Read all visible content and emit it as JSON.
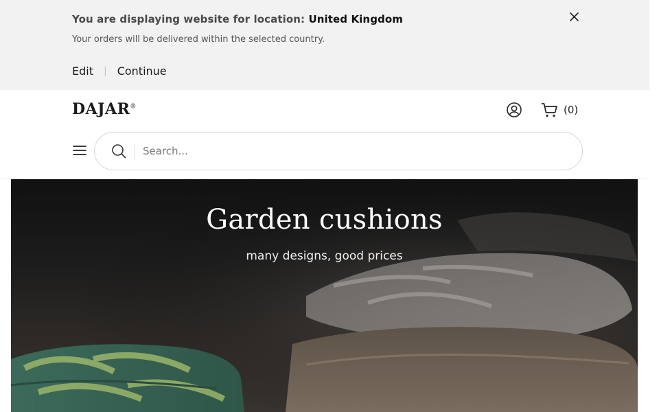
{
  "location_banner": {
    "title_prefix": "You are displaying website for location:",
    "country": "United Kingdom",
    "subtitle": "Your orders will be delivered within the selected country.",
    "edit_label": "Edit",
    "separator": "|",
    "continue_label": "Continue",
    "close_icon": "close-icon"
  },
  "header": {
    "logo_text": "DAJAR",
    "logo_mark": "®",
    "account_icon": "user-circle-icon",
    "cart_icon": "shopping-cart-icon",
    "cart_count": "(0)",
    "menu_icon": "hamburger-menu-icon"
  },
  "search": {
    "placeholder": "Search...",
    "value": "",
    "icon": "search-icon"
  },
  "hero": {
    "title": "Garden cushions",
    "subtitle": "many designs, good prices"
  },
  "colors": {
    "banner_bg": "#f2f2f2",
    "text_dark": "#1a1a1a",
    "hero_text": "#fbfbfb"
  }
}
